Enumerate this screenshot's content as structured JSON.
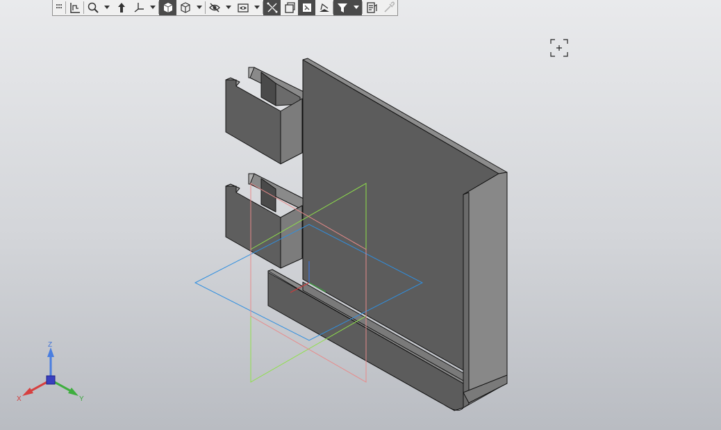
{
  "toolbar": {
    "buttons": [
      {
        "name": "grip",
        "icon": "grip-icon"
      },
      {
        "name": "sketch",
        "icon": "sketch-icon"
      },
      {
        "name": "zoom",
        "icon": "zoom-icon"
      },
      {
        "name": "orient",
        "icon": "orient-icon"
      },
      {
        "name": "axes",
        "icon": "axes-icon"
      },
      {
        "name": "shaded",
        "icon": "shaded-cube-icon"
      },
      {
        "name": "wireframe",
        "icon": "wireframe-cube-icon"
      },
      {
        "name": "hide",
        "icon": "hide-icon"
      },
      {
        "name": "show",
        "icon": "show-icon"
      },
      {
        "name": "dimensions",
        "icon": "dimensions-icon"
      },
      {
        "name": "layers",
        "icon": "layers-icon"
      },
      {
        "name": "properties",
        "icon": "properties-icon"
      },
      {
        "name": "sections",
        "icon": "sections-icon"
      },
      {
        "name": "filter",
        "icon": "filter-icon"
      },
      {
        "name": "report",
        "icon": "report-icon"
      },
      {
        "name": "eyedropper",
        "icon": "eyedropper-icon"
      }
    ]
  },
  "triad": {
    "x": "X",
    "y": "Y",
    "z": "Z"
  },
  "colors": {
    "plane_xy": "#2f8fe0",
    "plane_yz": "#8fe04a",
    "plane_xz": "#e88a8a",
    "axis_x": "#d23a3a",
    "axis_y": "#3aa63a",
    "axis_z": "#3f73d8"
  }
}
